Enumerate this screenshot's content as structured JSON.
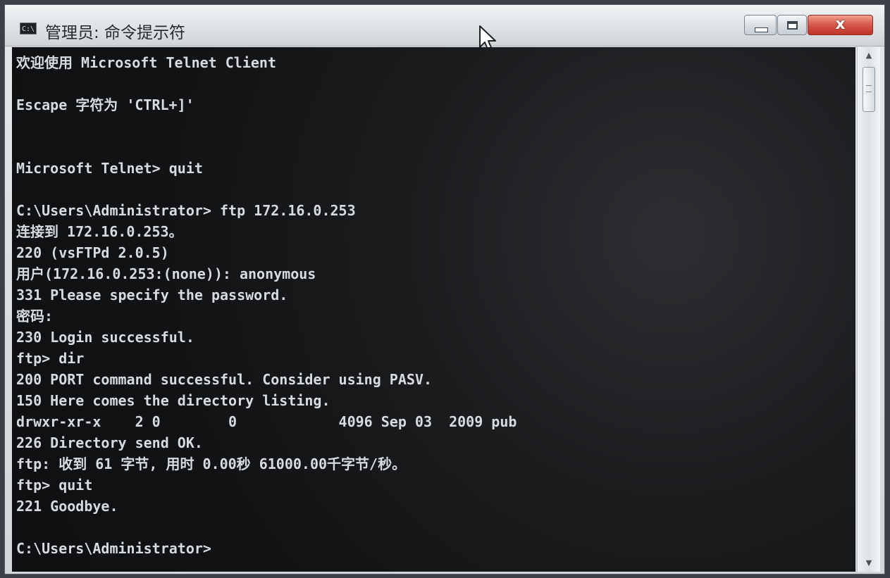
{
  "window": {
    "title": "管理员: 命令提示符",
    "icon_text": "C:\\",
    "controls": {
      "minimize": "minimize-icon",
      "maximize": "maximize-icon",
      "close": "close-icon",
      "close_glyph": "x"
    }
  },
  "console": {
    "lines": [
      "欢迎使用 Microsoft Telnet Client",
      "Escape 字符为 'CTRL+]'",
      "Microsoft Telnet> quit",
      "C:\\Users\\Administrator> ftp 172.16.0.253",
      "连接到 172.16.0.253。",
      "220 (vsFTPd 2.0.5)",
      "用户(172.16.0.253:(none)): anonymous",
      "331 Please specify the password.",
      "密码:",
      "230 Login successful.",
      "ftp> dir",
      "200 PORT command successful. Consider using PASV.",
      "150 Here comes the directory listing.",
      "drwxr-xr-x    2 0        0            4096 Sep 03  2009 pub",
      "226 Directory send OK.",
      "ftp: 收到 61 字节, 用时 0.00秒 61000.00千字节/秒。",
      "ftp> quit",
      "221 Goodbye.",
      "C:\\Users\\Administrator>"
    ]
  },
  "scrollbar": {
    "up": "▲",
    "down": "▼"
  }
}
